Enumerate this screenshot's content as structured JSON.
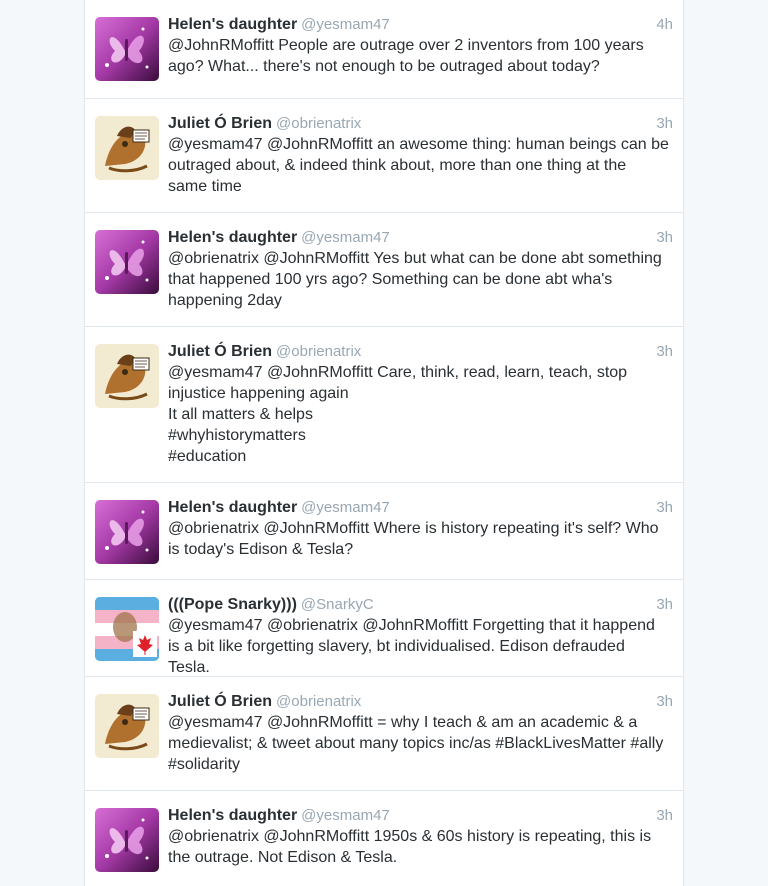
{
  "colors": {
    "name": "#292f33",
    "meta": "#99a7b3",
    "text": "#292f33",
    "divider": "#e1e8ed",
    "background": "#f5f8fa"
  },
  "tweets": [
    {
      "avatar": "butterfly-avatar",
      "name": "Helen's daughter",
      "handle": "@yesmam47",
      "time": "4h",
      "text": "@JohnRMoffitt People are outrage over 2 inventors from 100 years ago? What...  there's not enough to be outraged about today?"
    },
    {
      "avatar": "manuscript-avatar",
      "name": "Juliet Ó Brien",
      "handle": "@obrienatrix",
      "time": "3h",
      "text": "@yesmam47 @JohnRMoffitt an awesome thing: human beings can be outraged about, & indeed think about, more than one thing at the same time"
    },
    {
      "avatar": "butterfly-avatar",
      "name": "Helen's daughter",
      "handle": "@yesmam47",
      "time": "3h",
      "text": "@obrienatrix @JohnRMoffitt Yes but what can be done abt something that happened 100 yrs ago? Something can be done abt wha's happening 2day"
    },
    {
      "avatar": "manuscript-avatar",
      "name": "Juliet Ó Brien",
      "handle": "@obrienatrix",
      "time": "3h",
      "text": "@yesmam47 @JohnRMoffitt Care, think, read, learn, teach, stop injustice happening again\nIt all matters & helps\n#whyhistorymatters\n#education"
    },
    {
      "avatar": "butterfly-avatar",
      "name": "Helen's daughter",
      "handle": "@yesmam47",
      "time": "3h",
      "text": "@obrienatrix @JohnRMoffitt Where is history repeating it's self? Who is today's Edison & Tesla?"
    },
    {
      "avatar": "flag-avatar",
      "name": "(((Pope Snarky)))",
      "handle": "@SnarkyC",
      "time": "3h",
      "text": "@yesmam47 @obrienatrix @JohnRMoffitt Forgetting that it happend is a bit like forgetting slavery, bt individualised. Edison defrauded Tesla."
    },
    {
      "avatar": "manuscript-avatar",
      "name": "Juliet Ó Brien",
      "handle": "@obrienatrix",
      "time": "3h",
      "text": "@yesmam47 @JohnRMoffitt = why I teach & am an academic & a medievalist; & tweet about many topics inc/as #BlackLivesMatter #ally #solidarity"
    },
    {
      "avatar": "butterfly-avatar",
      "name": "Helen's daughter",
      "handle": "@yesmam47",
      "time": "3h",
      "text": "@obrienatrix @JohnRMoffitt 1950s & 60s history is repeating, this is the outrage. Not Edison & Tesla."
    }
  ]
}
